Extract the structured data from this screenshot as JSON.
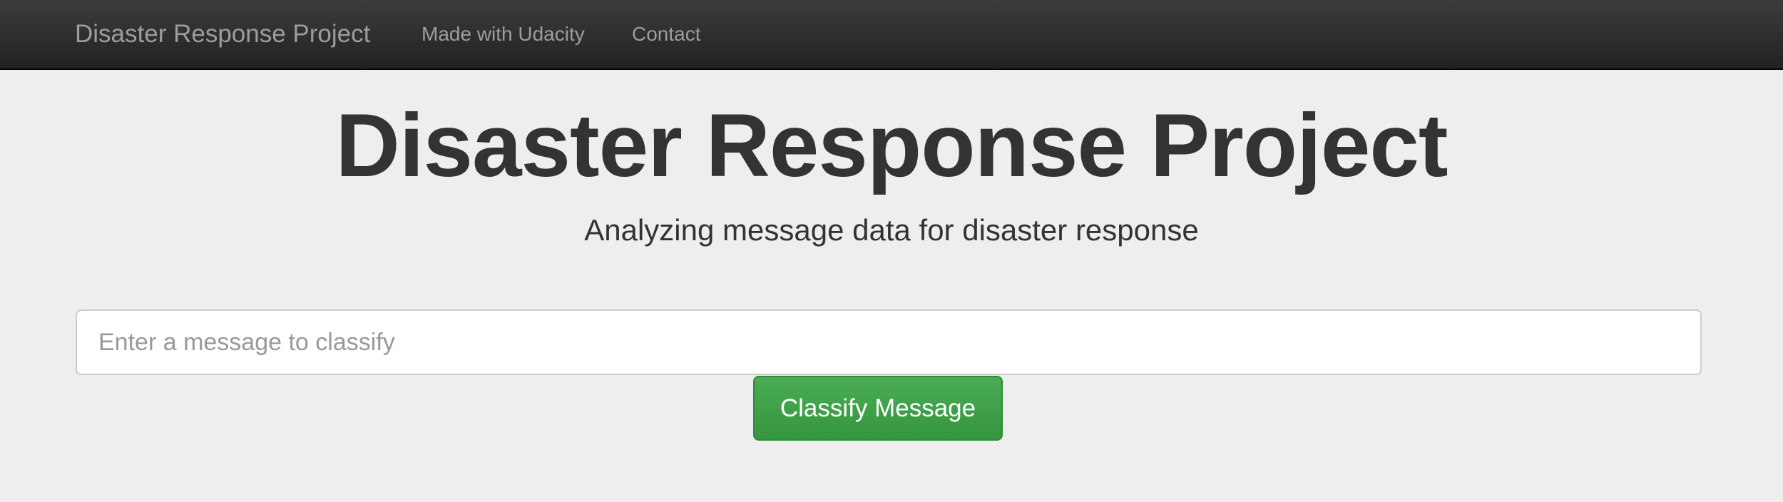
{
  "navbar": {
    "brand": "Disaster Response Project",
    "links": [
      {
        "label": "Made with Udacity"
      },
      {
        "label": "Contact"
      }
    ]
  },
  "hero": {
    "title": "Disaster Response Project",
    "subtitle": "Analyzing message data for disaster response"
  },
  "form": {
    "input_value": "",
    "input_placeholder": "Enter a message to classify",
    "submit_label": "Classify Message"
  },
  "colors": {
    "navbar_background": "#222222",
    "navbar_text": "#9d9d9d",
    "page_background": "#eeeeee",
    "heading_text": "#333333",
    "button_green": "#3c9e45"
  }
}
